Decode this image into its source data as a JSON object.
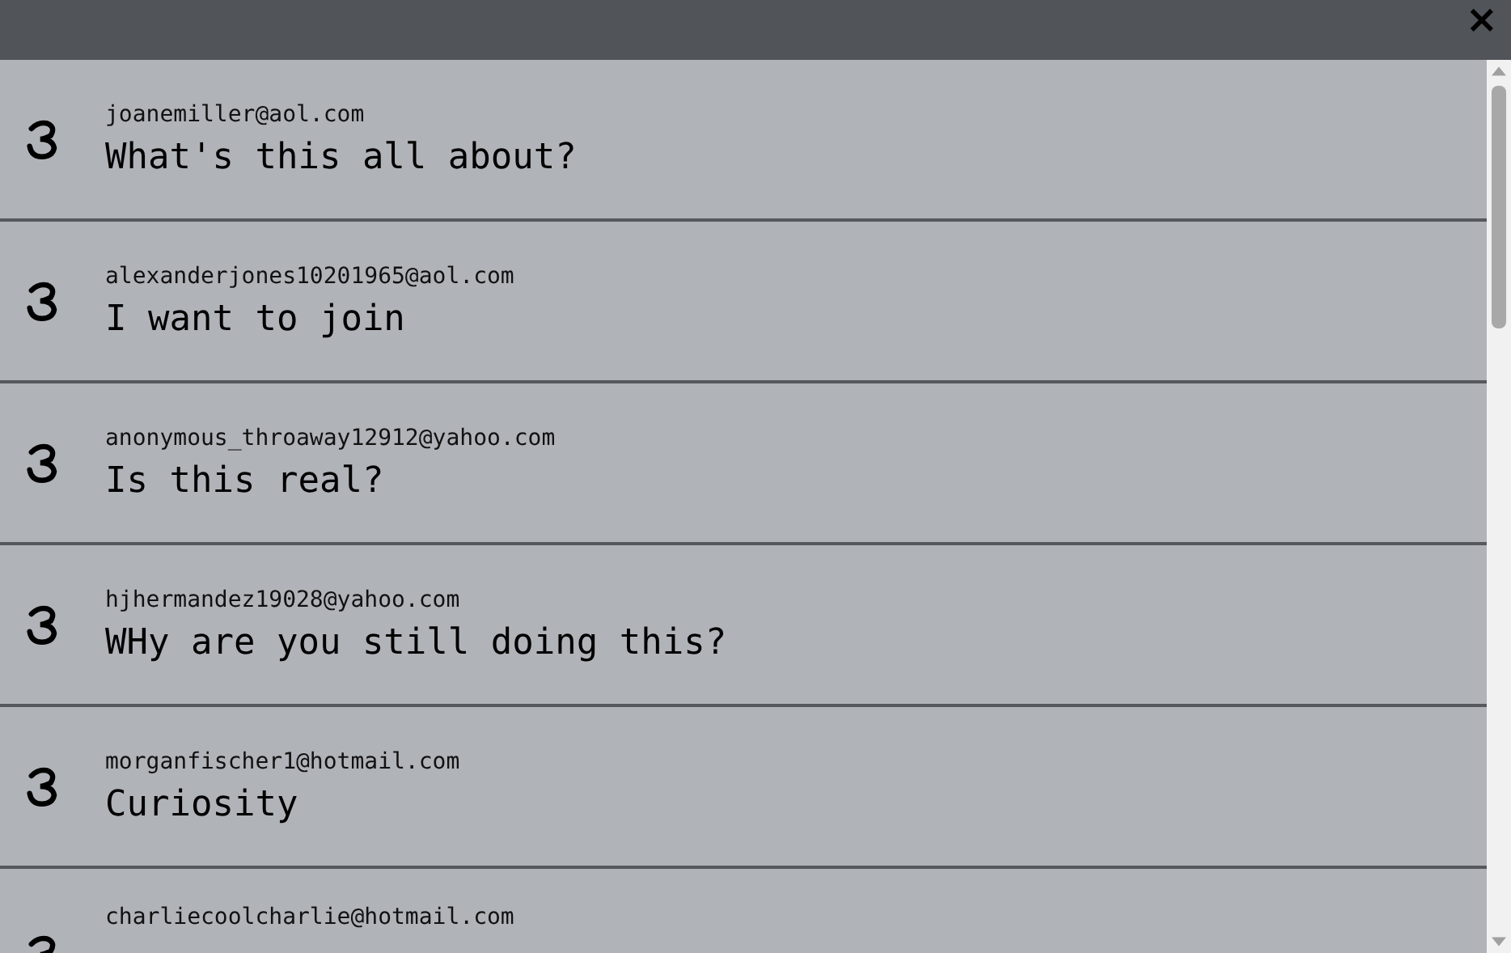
{
  "header": {
    "close_label": "×"
  },
  "messages": [
    {
      "email": "joanemiller@aol.com",
      "text": "What's this all about?"
    },
    {
      "email": "alexanderjones10201965@aol.com",
      "text": "I want to join"
    },
    {
      "email": "anonymous_throaway12912@yahoo.com",
      "text": "Is this real?"
    },
    {
      "email": "hjhermandez19028@yahoo.com",
      "text": "WHy are you still doing this?"
    },
    {
      "email": "morganfischer1@hotmail.com",
      "text": "Curiosity"
    },
    {
      "email": "charliecoolcharlie@hotmail.com"
    }
  ]
}
